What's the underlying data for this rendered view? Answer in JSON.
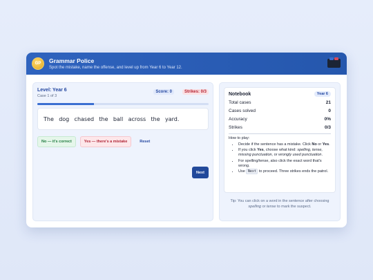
{
  "header": {
    "badge": "GP",
    "title": "Grammar Police",
    "subtitle": "Spot the mistake, name the offense, and level up from Year 6 to Year 12.",
    "icon": "police-bag-icon"
  },
  "game": {
    "level_label": "Level: Year 6",
    "case_label": "Case 1 of 3",
    "score_label": "Score: 0",
    "strikes_label": "Strikes: 0/3",
    "progress": 0.33,
    "sentence_words": [
      "The",
      "dog",
      "chased",
      "the",
      "ball",
      "across",
      "the",
      "yard."
    ],
    "buttons": {
      "no": "No — it's correct",
      "yes": "Yes — there's a mistake",
      "reset": "Reset",
      "next": "Next"
    }
  },
  "notebook": {
    "title": "Notebook",
    "year_chip": "Year 6",
    "stats": [
      {
        "label": "Total cases",
        "value": "21"
      },
      {
        "label": "Cases solved",
        "value": "0"
      },
      {
        "label": "Accuracy",
        "value": "0%"
      },
      {
        "label": "Strikes",
        "value": "0/3"
      }
    ],
    "howto_title": "How to play:",
    "howto": {
      "i1_a": "Decide if the sentence has a mistake. Click ",
      "i1_no": "No",
      "i1_b": " or ",
      "i1_yes": "Yes",
      "i1_c": ".",
      "i2_a": "If you click ",
      "i2_yes": "Yes",
      "i2_b": ", choose what kind: ",
      "i2_kinds": "spelling, tense, missing punctuation,",
      "i2_c": " or ",
      "i2_kind_last": "wrongly used punctuation",
      "i2_d": ".",
      "i3": "For spelling/tense, also click the exact word that's wrong.",
      "i4_a": "Use ",
      "i4_key": "Next",
      "i4_b": " to proceed. Three strikes ends the patrol."
    },
    "tip": {
      "a": "Tip: You can click on a word in the sentence after choosing ",
      "spelling": "spelling",
      "b": " or ",
      "tense": "tense",
      "c": " to mark the suspect."
    }
  },
  "colors": {
    "header": "#2f63be",
    "accent": "#2447a0",
    "danger": "#b52232",
    "success": "#1d7a3d"
  }
}
